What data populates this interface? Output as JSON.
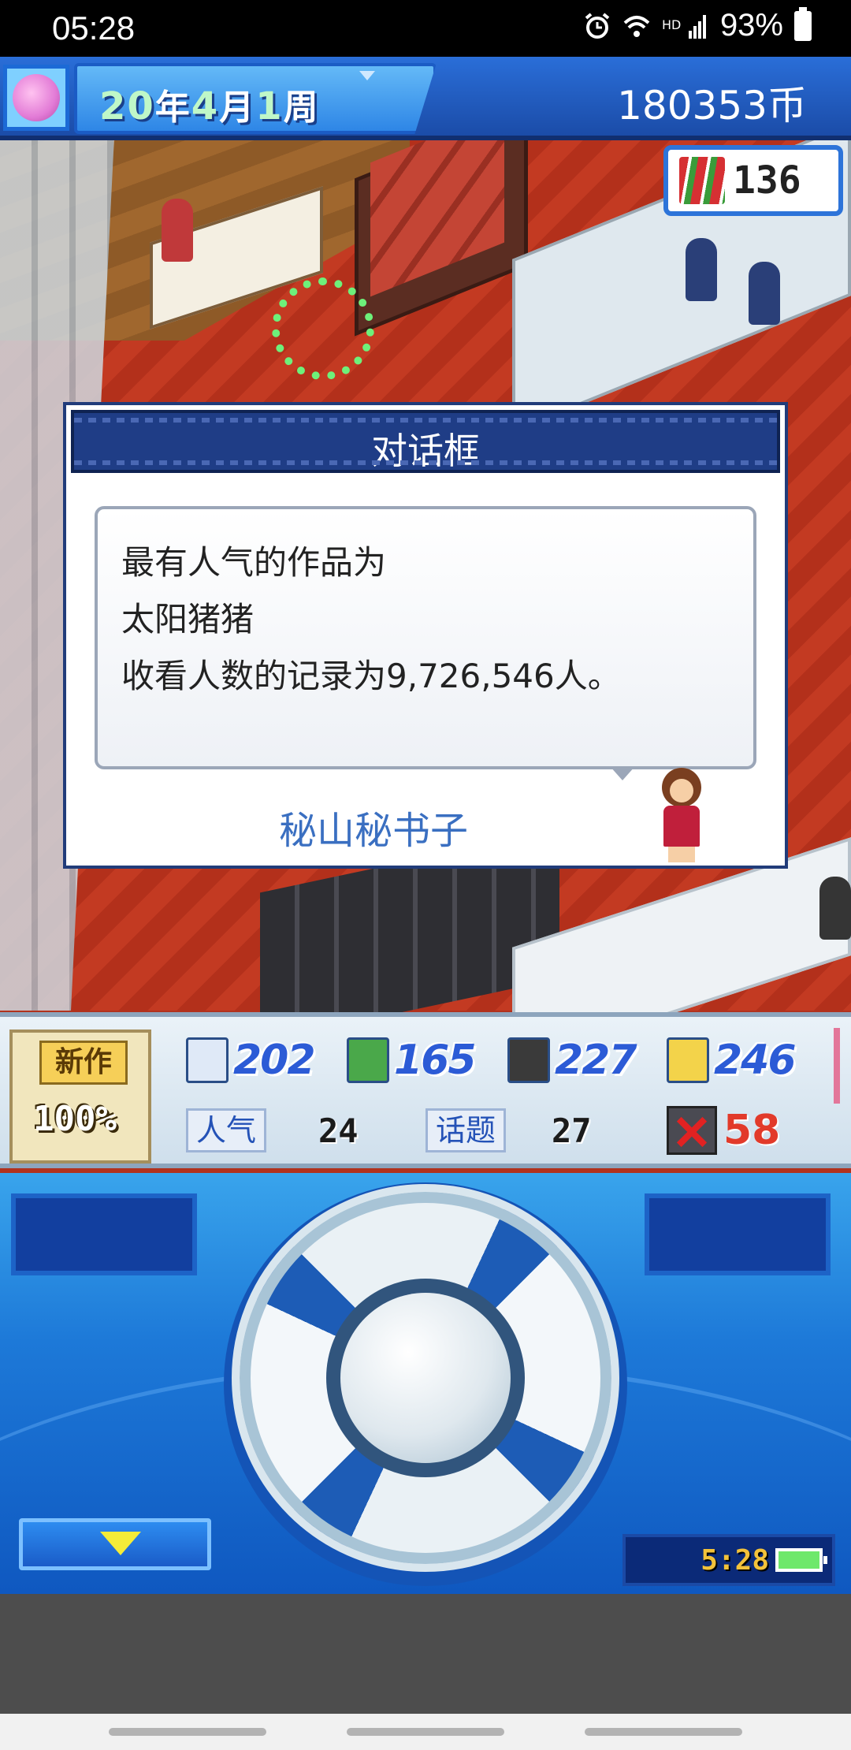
{
  "status_bar": {
    "time": "05:28",
    "battery": "93%",
    "icons": [
      "alarm-icon",
      "wifi-icon",
      "hd-4g-signal-icon",
      "battery-icon"
    ]
  },
  "hud": {
    "date": {
      "year": "20",
      "year_unit": "年",
      "month": "4",
      "month_unit": "月",
      "week": "1",
      "week_unit": "周"
    },
    "coins": "180353币",
    "fans": "136"
  },
  "dialog": {
    "title": "对话框",
    "lines": [
      "最有人气的作品为",
      "太阳猪猪",
      "收看人数的记录为9,726,546人。"
    ],
    "speaker": "秘山秘书子"
  },
  "stats": {
    "new_work_label": "新作",
    "new_work_progress": "100%",
    "scores": [
      {
        "icon": "script-icon",
        "value": "202",
        "color": "#2c5bd6"
      },
      {
        "icon": "staff-icon",
        "value": "165",
        "color": "#2c5bd6"
      },
      {
        "icon": "camera-icon",
        "value": "227",
        "color": "#2c5bd6"
      },
      {
        "icon": "music-note-icon",
        "value": "246",
        "color": "#2c5bd6"
      }
    ],
    "popularity_label": "人气",
    "popularity_value": "24",
    "topic_label": "话题",
    "topic_value": "27",
    "bugs_value": "58"
  },
  "controller": {
    "clock_time": "5:28"
  },
  "colors": {
    "hud_blue": "#1b4ca8",
    "dialog_header": "#1f3d86",
    "speaker_text": "#3a6fc1",
    "stat_value": "#2c5bd6",
    "bug_red": "#e23a2a"
  }
}
